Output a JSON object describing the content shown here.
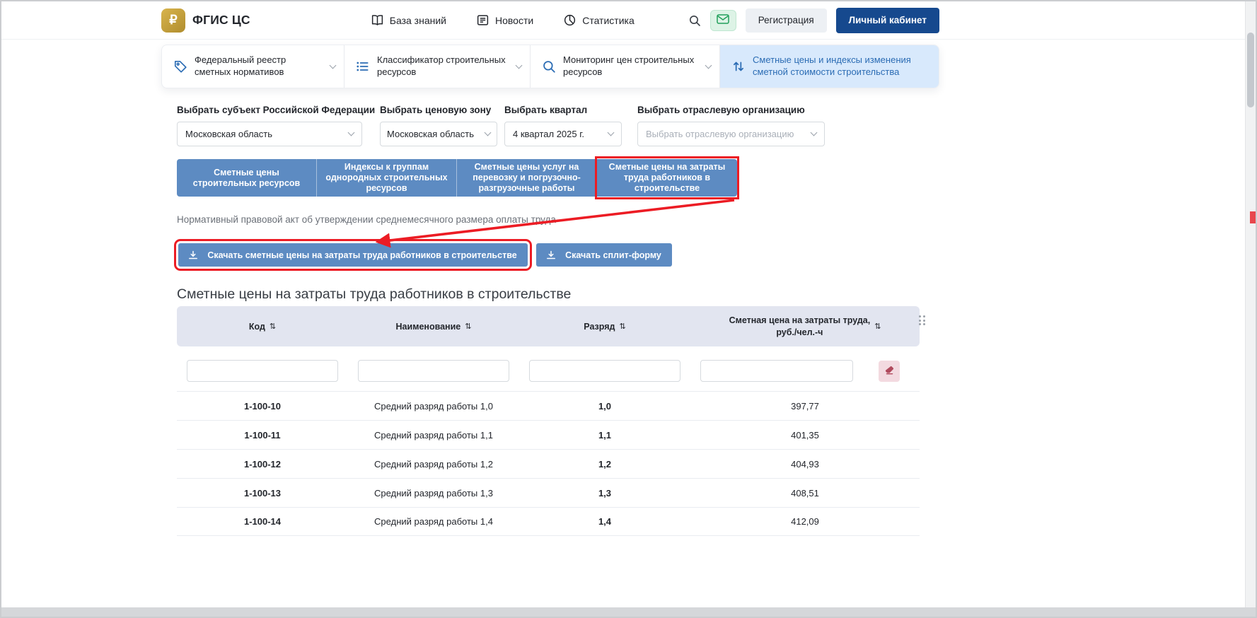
{
  "colors": {
    "brand_gold": "#C5A13E",
    "accent_blue": "#5D8BC2",
    "active_tab_bg": "#D8E9FC",
    "link_blue": "#2B6CB4",
    "dark_navy_button": "#16498E",
    "annotation_red": "#EC1C24",
    "table_header_bg": "#E2E5F0",
    "mail_green": "#22A05B"
  },
  "header": {
    "logo_glyph": "₽",
    "brand": "ФГИС ЦС",
    "nav_items": [
      {
        "label": "База знаний",
        "icon": "book-icon"
      },
      {
        "label": "Новости",
        "icon": "news-icon"
      },
      {
        "label": "Статистика",
        "icon": "stats-icon"
      }
    ],
    "register_button": "Регистрация",
    "account_button": "Личный кабинет"
  },
  "nav_tabs": [
    {
      "label": "Федеральный реестр сметных нормативов",
      "icon": "tag-icon",
      "active": false,
      "chevron": true
    },
    {
      "label": "Классификатор строительных ресурсов",
      "icon": "classifier-list-icon",
      "active": false,
      "chevron": true
    },
    {
      "label": "Мониторинг цен строительных ресурсов",
      "icon": "monitoring-search-icon",
      "active": false,
      "chevron": true
    },
    {
      "label": "Сметные цены и индексы изменения сметной стоимости строительства",
      "icon": "sort-arrows-icon",
      "active": true,
      "chevron": false
    }
  ],
  "filters": [
    {
      "label": "Выбрать субъект Российской Федерации",
      "value": "Московская область",
      "placeholder": ""
    },
    {
      "label": "Выбрать ценовую зону",
      "value": "Московская область",
      "placeholder": ""
    },
    {
      "label": "Выбрать квартал",
      "value": "4 квартал 2025 г.",
      "placeholder": ""
    },
    {
      "label": "Выбрать отраслевую организацию",
      "value": "",
      "placeholder": "Выбрать отраслевую организацию"
    }
  ],
  "segment_tabs": [
    {
      "label": "Сметные цены строительных ресурсов",
      "highlighted": false
    },
    {
      "label": "Индексы к группам однородных строительных ресурсов",
      "highlighted": false
    },
    {
      "label": "Сметные цены услуг на перевозку и погрузочно-разгрузочные работы",
      "highlighted": false
    },
    {
      "label": "Сметные цены на затраты труда работников в строительстве",
      "highlighted": true
    }
  ],
  "npa_link": "Нормативный правовой акт об утверждении среднемесячного размера оплаты труда",
  "download_buttons": [
    {
      "label": "Скачать сметные цены на затраты труда работников в строительстве",
      "icon": "download-icon",
      "highlighted": true
    },
    {
      "label": "Скачать сплит-форму",
      "icon": "download-icon",
      "highlighted": false
    }
  ],
  "section_title": "Сметные цены на затраты труда работников в строительстве",
  "table": {
    "columns": [
      {
        "label": "Код",
        "sortable": true
      },
      {
        "label": "Наименование",
        "sortable": true
      },
      {
        "label": "Разряд",
        "sortable": true
      },
      {
        "label": "Сметная цена на затраты труда, руб./чел.-ч",
        "lines": [
          "Сметная цена на затраты труда,",
          "руб./чел.-ч"
        ],
        "sortable": true
      }
    ],
    "filter_inputs": [
      {
        "value": "",
        "placeholder": ""
      },
      {
        "value": "",
        "placeholder": ""
      },
      {
        "value": "",
        "placeholder": ""
      },
      {
        "value": "",
        "placeholder": ""
      }
    ],
    "rows": [
      {
        "code": "1-100-10",
        "name": "Средний разряд работы 1,0",
        "grade": "1,0",
        "price": "397,77"
      },
      {
        "code": "1-100-11",
        "name": "Средний разряд работы 1,1",
        "grade": "1,1",
        "price": "401,35"
      },
      {
        "code": "1-100-12",
        "name": "Средний разряд работы 1,2",
        "grade": "1,2",
        "price": "404,93"
      },
      {
        "code": "1-100-13",
        "name": "Средний разряд работы 1,3",
        "grade": "1,3",
        "price": "408,51"
      },
      {
        "code": "1-100-14",
        "name": "Средний разряд работы 1,4",
        "grade": "1,4",
        "price": "412,09"
      }
    ]
  }
}
